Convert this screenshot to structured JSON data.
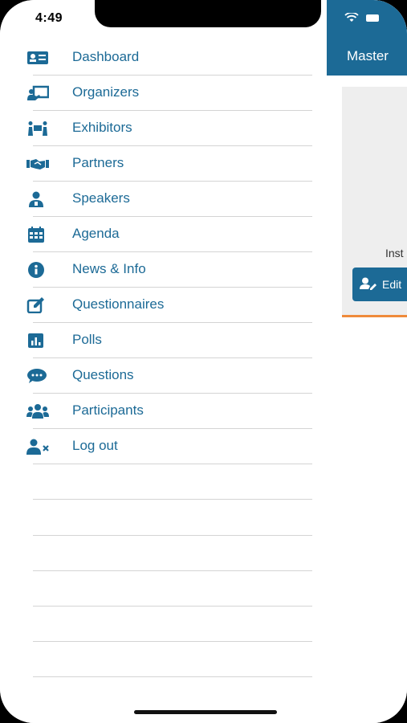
{
  "status": {
    "time": "4:49"
  },
  "menu": {
    "items": [
      {
        "label": "Dashboard",
        "icon": "id-card-icon"
      },
      {
        "label": "Organizers",
        "icon": "presentation-icon"
      },
      {
        "label": "Exhibitors",
        "icon": "exhibitors-icon"
      },
      {
        "label": "Partners",
        "icon": "handshake-icon"
      },
      {
        "label": "Speakers",
        "icon": "speaker-icon"
      },
      {
        "label": "Agenda",
        "icon": "calendar-icon"
      },
      {
        "label": "News & Info",
        "icon": "info-icon"
      },
      {
        "label": "Questionnaires",
        "icon": "edit-icon"
      },
      {
        "label": "Polls",
        "icon": "poll-icon"
      },
      {
        "label": "Questions",
        "icon": "chat-icon"
      },
      {
        "label": "Participants",
        "icon": "users-icon"
      },
      {
        "label": "Log out",
        "icon": "user-remove-icon"
      }
    ]
  },
  "background": {
    "header_title": "Master",
    "card_text": "Inst",
    "edit_button": "Edit"
  },
  "colors": {
    "accent": "#1c6a96",
    "orange": "#ef8a3a",
    "divider": "#d4d4d4"
  }
}
